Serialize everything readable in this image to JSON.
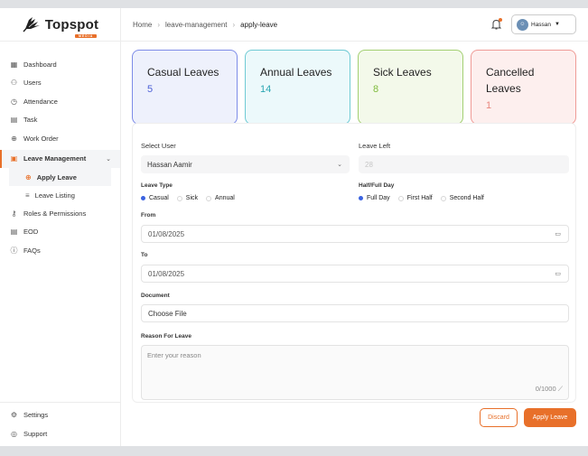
{
  "brand": {
    "name": "Topspot",
    "badge": "MEDIA"
  },
  "breadcrumb": {
    "home": "Home",
    "section": "leave-management",
    "current": "apply-leave"
  },
  "header": {
    "user_name": "Hassan"
  },
  "sidebar": {
    "items": [
      {
        "label": "Dashboard",
        "icon": "grid-icon"
      },
      {
        "label": "Users",
        "icon": "users-icon"
      },
      {
        "label": "Attendance",
        "icon": "clock-icon"
      },
      {
        "label": "Task",
        "icon": "clipboard-icon"
      },
      {
        "label": "Work Order",
        "icon": "globe-icon"
      }
    ],
    "group": {
      "label": "Leave Management",
      "icon": "calendar-icon"
    },
    "subitems": [
      {
        "label": "Apply Leave",
        "icon": "plus-circle-icon"
      },
      {
        "label": "Leave Listing",
        "icon": "list-icon"
      }
    ],
    "items2": [
      {
        "label": "Roles & Permissions",
        "icon": "key-icon"
      },
      {
        "label": "EOD",
        "icon": "clipboard-icon"
      },
      {
        "label": "FAQs",
        "icon": "help-icon"
      }
    ],
    "bottom": [
      {
        "label": "Settings",
        "icon": "gear-icon"
      },
      {
        "label": "Support",
        "icon": "support-icon"
      }
    ]
  },
  "cards": [
    {
      "title": "Casual Leaves",
      "value": "5",
      "color": "#4b5fd6"
    },
    {
      "title": "Annual Leaves",
      "value": "14",
      "color": "#2aa6b3"
    },
    {
      "title": "Sick Leaves",
      "value": "8",
      "color": "#7fbb3c"
    },
    {
      "title": "Cancelled Leaves",
      "value": "1",
      "color": "#e8877e"
    }
  ],
  "form": {
    "select_user_label": "Select User",
    "select_user_value": "Hassan Aamir",
    "leave_left_label": "Leave Left",
    "leave_left_value": "28",
    "leave_type_label": "Leave Type",
    "leave_types": [
      "Casual",
      "Sick",
      "Annual"
    ],
    "half_full_label": "Half/Full Day",
    "half_full_options": [
      "Full Day",
      "First Half",
      "Second Half"
    ],
    "from_label": "From",
    "from_value": "01/08/2025",
    "to_label": "To",
    "to_value": "01/08/2025",
    "document_label": "Document",
    "document_button": "Choose File",
    "reason_label": "Reason For Leave",
    "reason_placeholder": "Enter your reason",
    "reason_counter": "0/1000"
  },
  "actions": {
    "discard": "Discard",
    "apply": "Apply Leave"
  },
  "accent_color": "#e8702a"
}
